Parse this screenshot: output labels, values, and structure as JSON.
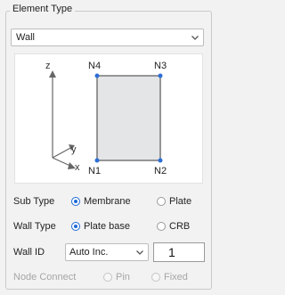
{
  "group": {
    "title": "Element Type"
  },
  "element_type": {
    "selected": "Wall"
  },
  "diagram": {
    "axis_z": "z",
    "axis_y": "y",
    "axis_x": "x",
    "nodes": {
      "n1": "N1",
      "n2": "N2",
      "n3": "N3",
      "n4": "N4"
    },
    "colors": {
      "node": "#2d6fd6",
      "panel_fill": "#e3e5e7",
      "panel_stroke": "#777777"
    }
  },
  "sub_type": {
    "label": "Sub Type",
    "options": [
      "Membrane",
      "Plate"
    ],
    "selected": "Membrane"
  },
  "wall_type": {
    "label": "Wall Type",
    "options": [
      "Plate base",
      "CRB"
    ],
    "selected": "Plate base"
  },
  "wall_id": {
    "label": "Wall ID",
    "selected": "Auto Inc.",
    "value": "1"
  },
  "node_connect": {
    "label": "Node Connect",
    "options": [
      "Pin",
      "Fixed"
    ],
    "enabled": false
  },
  "colors": {
    "accent": "#1e6ad6",
    "background": "#f2f2f2"
  }
}
